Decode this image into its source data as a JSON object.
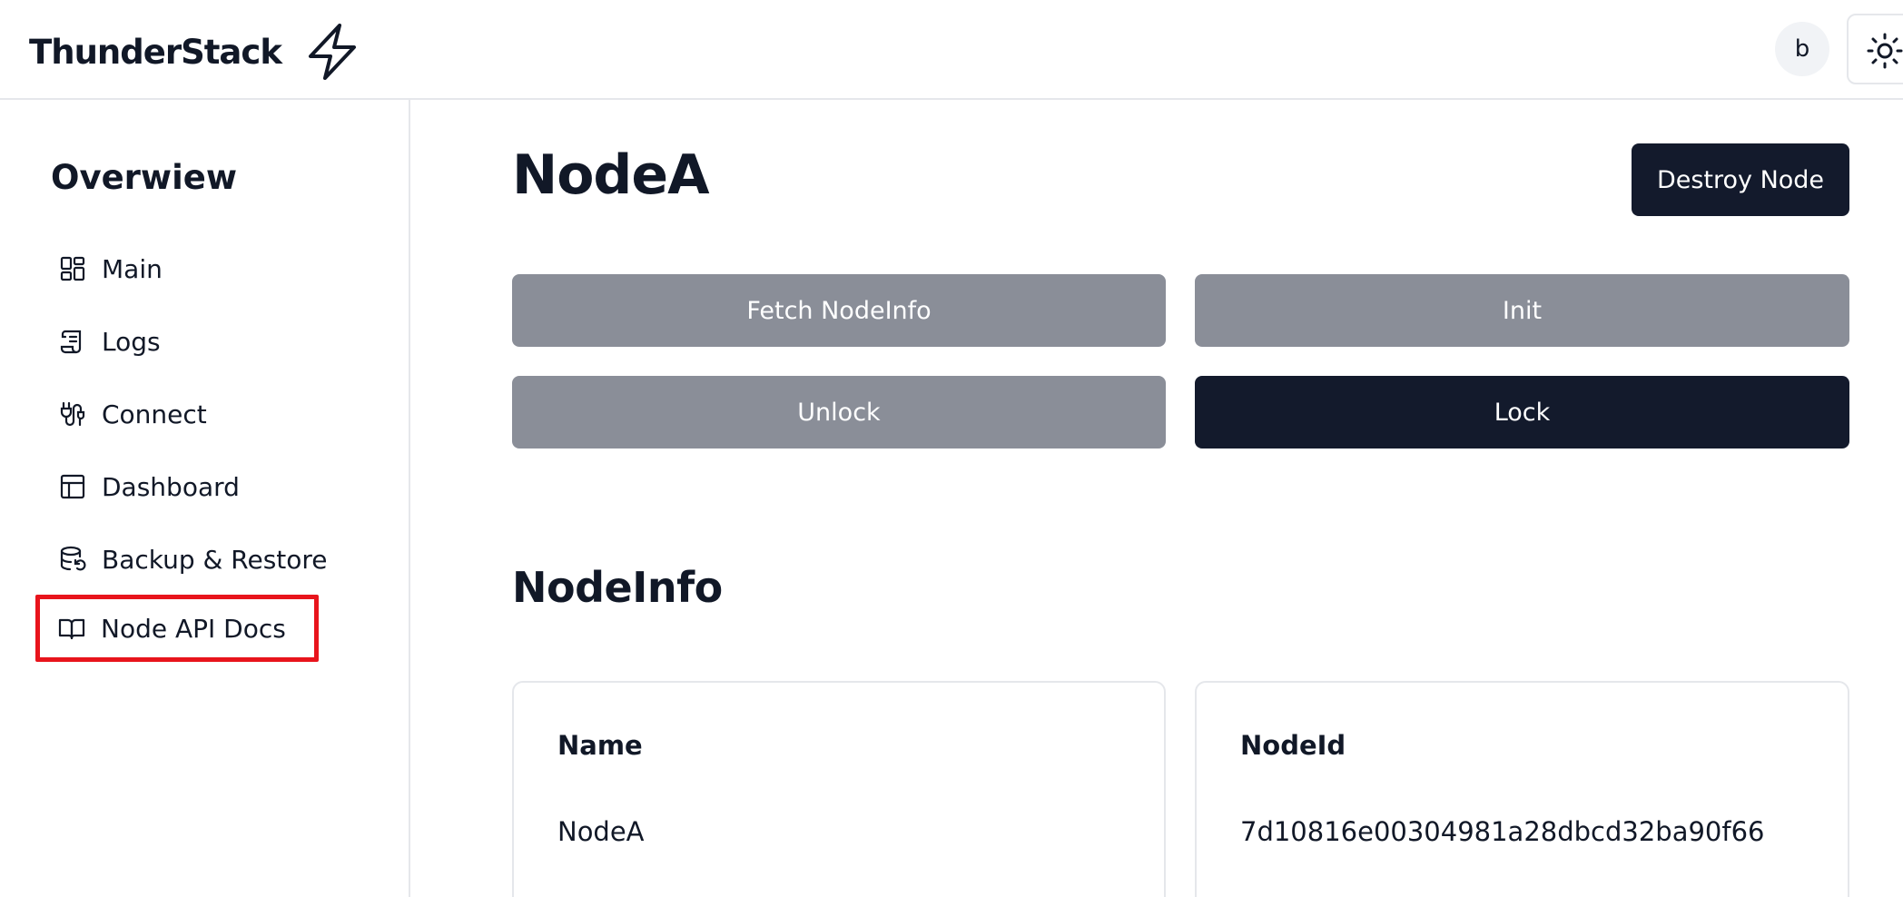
{
  "header": {
    "brand": "ThunderStack",
    "logo_icon": "lightning-bolt-icon",
    "avatar_initial": "b",
    "theme_icon": "sun-icon"
  },
  "sidebar": {
    "title": "Overwiew",
    "items": [
      {
        "label": "Main",
        "icon": "dashboard-grid-icon"
      },
      {
        "label": "Logs",
        "icon": "scroll-icon"
      },
      {
        "label": "Connect",
        "icon": "plug-icon"
      },
      {
        "label": "Dashboard",
        "icon": "layout-icon"
      },
      {
        "label": "Backup & Restore",
        "icon": "database-restore-icon"
      },
      {
        "label": "Node API Docs",
        "icon": "book-icon",
        "highlighted": true
      }
    ]
  },
  "main": {
    "title": "NodeA",
    "destroy_label": "Destroy Node",
    "actions": {
      "fetch": "Fetch NodeInfo",
      "init": "Init",
      "unlock": "Unlock",
      "lock": "Lock"
    },
    "section_title": "NodeInfo",
    "cards": [
      {
        "label": "Name",
        "value": "NodeA"
      },
      {
        "label": "NodeId",
        "value": "7d10816e00304981a28dbcd32ba90f66"
      }
    ]
  },
  "colors": {
    "dark": "#131a2c",
    "gray_button": "#8a8e98",
    "highlight": "#e8141c",
    "border": "#e5e7eb"
  }
}
